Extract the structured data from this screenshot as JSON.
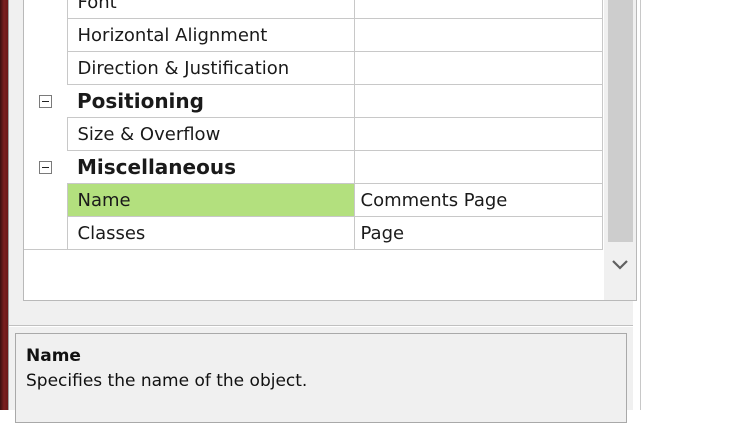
{
  "properties": {
    "rows": [
      {
        "kind": "property",
        "name": "Font",
        "value": ""
      },
      {
        "kind": "property",
        "name": "Horizontal Alignment",
        "value": ""
      },
      {
        "kind": "property",
        "name": "Direction & Justification",
        "value": ""
      },
      {
        "kind": "category",
        "name": "Positioning",
        "value": ""
      },
      {
        "kind": "property",
        "name": "Size & Overflow",
        "value": ""
      },
      {
        "kind": "category",
        "name": "Miscellaneous",
        "value": ""
      },
      {
        "kind": "property",
        "name": "Name",
        "value": "Comments Page",
        "selected": true
      },
      {
        "kind": "property",
        "name": "Classes",
        "value": "Page"
      }
    ],
    "selected_color": "#b3e07e"
  },
  "description": {
    "title": "Name",
    "text": "Specifies the name of the object."
  },
  "icons": {
    "collapse": "minus-box-icon",
    "scroll_down": "chevron-down-icon"
  }
}
